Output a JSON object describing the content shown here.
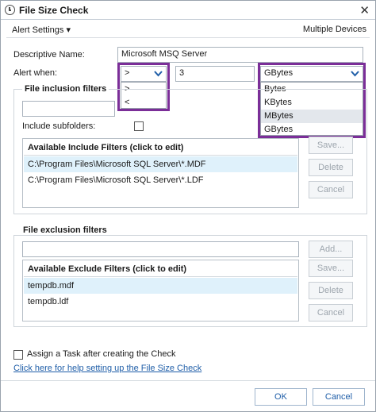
{
  "window": {
    "title": "File Size Check",
    "close_glyph": "✕"
  },
  "menu": {
    "alert_settings": "Alert Settings ▾",
    "multiple_devices": "Multiple Devices"
  },
  "form": {
    "descriptive_name_label": "Descriptive Name:",
    "descriptive_name_value": "Microsoft MSQ Server",
    "alert_when_label": "Alert when:",
    "operator_value": ">",
    "operator_options": [
      ">",
      "<"
    ],
    "threshold_value": "3",
    "unit_value": "GBytes",
    "unit_options": [
      "Bytes",
      "KBytes",
      "MBytes",
      "GBytes"
    ],
    "unit_hovered": "MBytes"
  },
  "inclusion": {
    "title": "File inclusion filters",
    "path_value": "",
    "include_subfolders_label": "Include subfolders:",
    "include_subfolders_checked": false,
    "list_header": "Available Include Filters (click to edit)",
    "items": [
      "C:\\Program Files\\Microsoft SQL Server\\*.MDF",
      "C:\\Program Files\\Microsoft SQL Server\\*.LDF"
    ],
    "buttons": {
      "save": "Save...",
      "delete": "Delete",
      "cancel": "Cancel"
    }
  },
  "exclusion": {
    "title": "File exclusion filters",
    "path_value": "",
    "list_header": "Available Exclude Filters (click to edit)",
    "items": [
      "tempdb.mdf",
      "tempdb.ldf"
    ],
    "buttons": {
      "add": "Add...",
      "save": "Save...",
      "delete": "Delete",
      "cancel": "Cancel"
    }
  },
  "task": {
    "assign_label": "Assign a Task after creating the Check",
    "assign_checked": false
  },
  "help_link": "Click here for help setting up the File Size Check",
  "footer": {
    "ok": "OK",
    "cancel": "Cancel"
  },
  "colors": {
    "highlight": "#7b2e98",
    "link": "#1f5ea8",
    "selection": "#dff1fb"
  }
}
